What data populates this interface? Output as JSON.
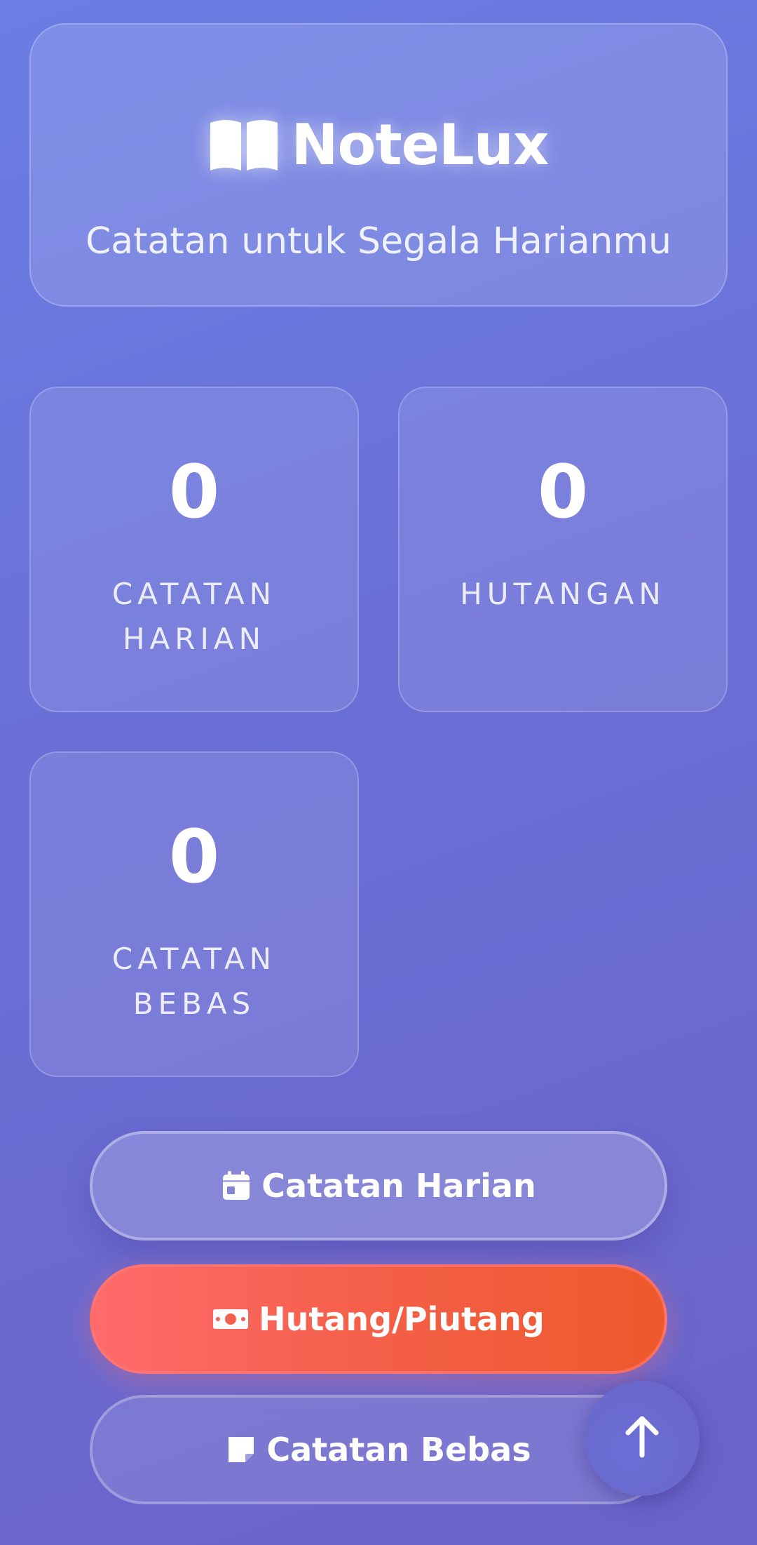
{
  "header": {
    "app_name": "NoteLux",
    "tagline": "Catatan untuk Segala Harianmu",
    "logo_icon": "book-open-icon"
  },
  "stats": [
    {
      "value": "0",
      "label": "CATATAN HARIAN"
    },
    {
      "value": "0",
      "label": "HUTANGAN"
    },
    {
      "value": "0",
      "label": "CATATAN BEBAS"
    }
  ],
  "buttons": {
    "daily": {
      "label": "Catatan Harian",
      "icon": "calendar-icon"
    },
    "debt": {
      "label": "Hutang/Piutang",
      "icon": "money-bill-icon"
    },
    "free": {
      "label": "Catatan Bebas",
      "icon": "sticky-note-icon"
    }
  },
  "fab": {
    "icon": "arrow-up-icon"
  },
  "colors": {
    "background_start": "#6b7ee4",
    "background_end": "#6a63c8",
    "debt_button_start": "#ff6b6b",
    "debt_button_end": "#ee5a2b"
  }
}
